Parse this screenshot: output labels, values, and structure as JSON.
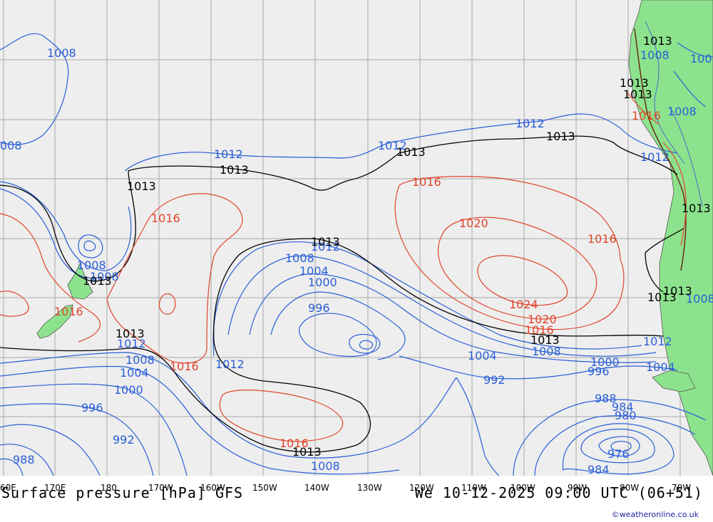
{
  "colors": {
    "ocean": "#eeeeee",
    "land": "#8de38d",
    "grid": "#a8a8a8",
    "isobar_low": "#2a5fd8",
    "isobar_1013": "#000000",
    "isobar_high": "#e0452c"
  },
  "longitude_ticks": [
    "60E",
    "170E",
    "180",
    "170W",
    "160W",
    "150W",
    "140W",
    "130W",
    "120W",
    "110W",
    "100W",
    "90W",
    "80W",
    "70W"
  ],
  "isobar_labels": {
    "blue": [
      "1008",
      "008",
      "1008",
      "1012",
      "1012",
      "1012",
      "1012",
      "1008",
      "1008",
      "1008",
      "1004",
      "1000",
      "996",
      "1012",
      "1008",
      "1004",
      "1000",
      "996",
      "992",
      "988",
      "1012",
      "1004",
      "1008",
      "992",
      "1000",
      "996",
      "988",
      "984",
      "980",
      "976",
      "984",
      "1008",
      "1004",
      "1012",
      "1008",
      "1008",
      "1012",
      "1008"
    ],
    "black": [
      "1013",
      "1013",
      "1013",
      "1013",
      "1013",
      "1013",
      "1013",
      "1013",
      "1013",
      "1013",
      "1013",
      "1013",
      "1013",
      "1013",
      "1013"
    ],
    "red": [
      "1016",
      "1016",
      "1016",
      "1016",
      "1020",
      "1024",
      "1020",
      "1016",
      "1016",
      "1016",
      "1016"
    ]
  },
  "footer": {
    "title": "Surface pressure [hPa] GFS",
    "valid_time": "We 10-12-2025 09:00 UTC (06+51)",
    "credit": "©weatheronline.co.uk"
  }
}
